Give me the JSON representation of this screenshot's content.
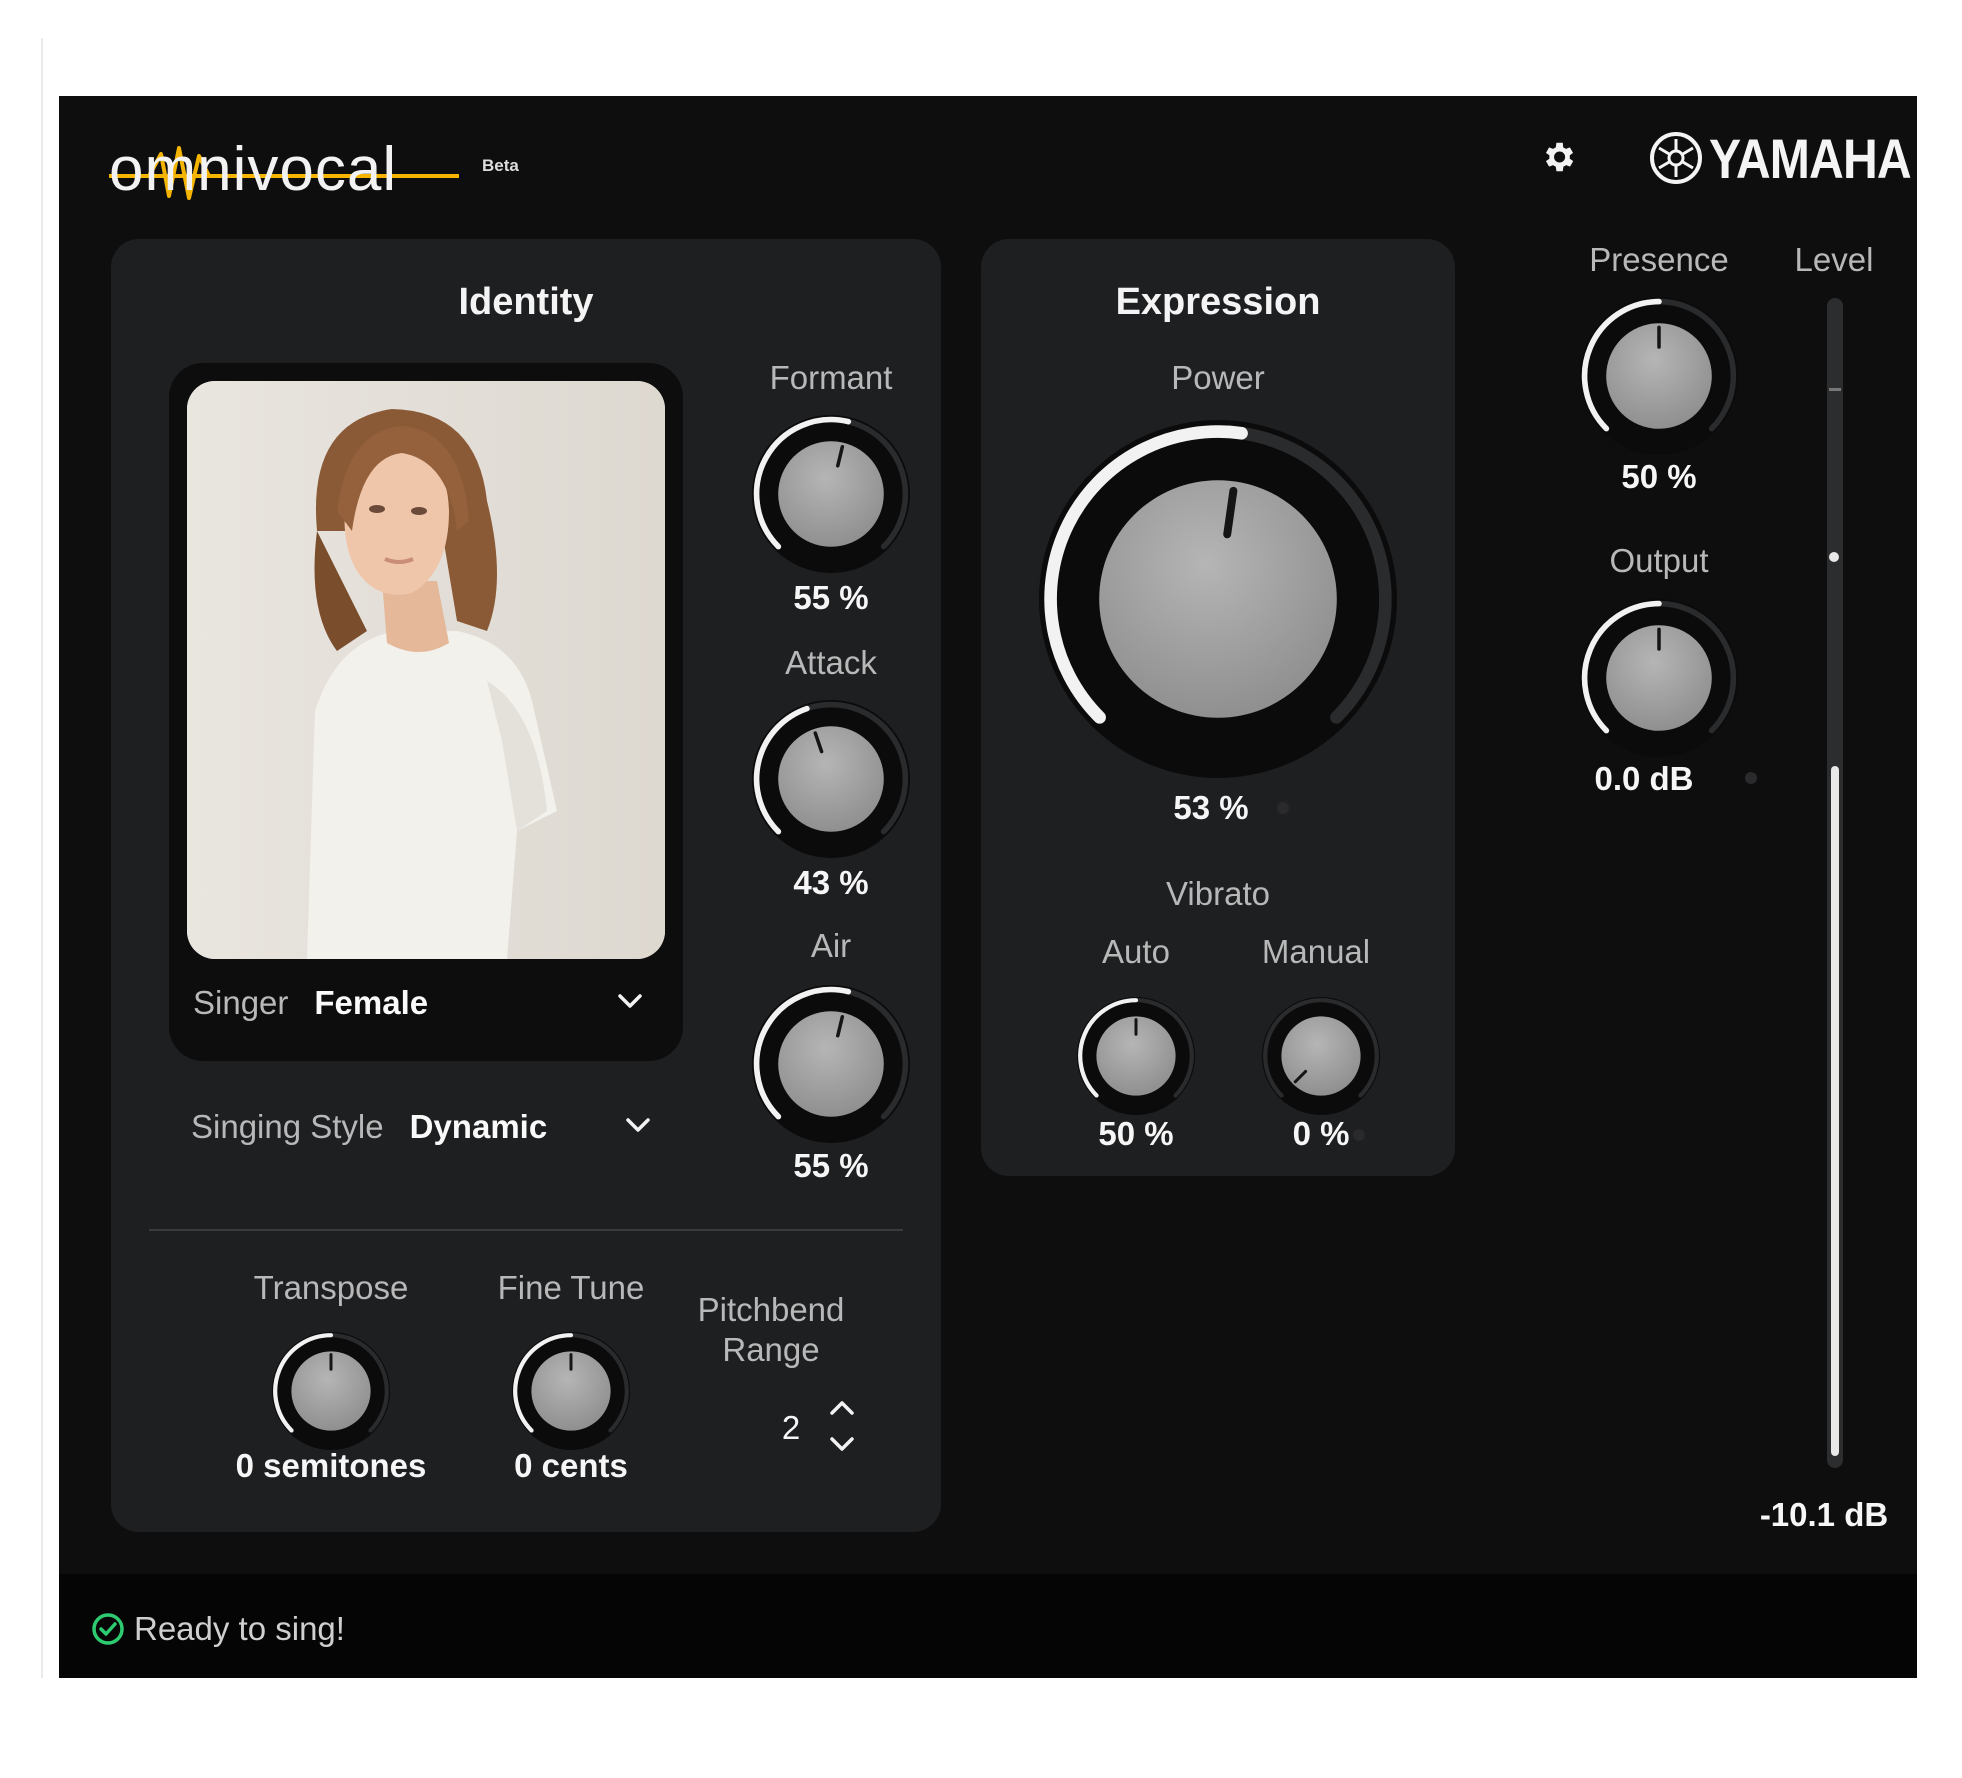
{
  "header": {
    "logo_text": "omnivocal",
    "beta_label": "Beta",
    "brand": "YAMAHA",
    "settings_icon": "gear-icon"
  },
  "identity": {
    "title": "Identity",
    "singer": {
      "label": "Singer",
      "value": "Female"
    },
    "singing_style": {
      "label": "Singing Style",
      "value": "Dynamic"
    },
    "formant": {
      "label": "Formant",
      "value": "55 %",
      "level": 0.55
    },
    "attack": {
      "label": "Attack",
      "value": "43 %",
      "level": 0.43
    },
    "air": {
      "label": "Air",
      "value": "55 %",
      "level": 0.55
    },
    "transpose": {
      "label": "Transpose",
      "value": "0 semitones",
      "level": 0.5
    },
    "fine_tune": {
      "label": "Fine Tune",
      "value": "0 cents",
      "level": 0.5
    },
    "pitchbend": {
      "label_line1": "Pitchbend",
      "label_line2": "Range",
      "value": "2"
    }
  },
  "expression": {
    "title": "Expression",
    "power": {
      "label": "Power",
      "value": "53 %",
      "level": 0.53
    },
    "vibrato": {
      "label": "Vibrato",
      "auto": {
        "label": "Auto",
        "value": "50 %",
        "level": 0.5
      },
      "manual": {
        "label": "Manual",
        "value": "0 %",
        "level": 0.0
      }
    }
  },
  "master": {
    "presence": {
      "label": "Presence",
      "value": "50 %",
      "level": 0.5
    },
    "output": {
      "label": "Output",
      "value": "0.0 dB",
      "level": 0.5
    },
    "level": {
      "label": "Level",
      "value": "-10.1 dB",
      "fill": 0.6
    }
  },
  "status": {
    "text": "Ready to sing!",
    "icon": "check-circle-icon",
    "color": "#2ecc71"
  },
  "colors": {
    "background": "#0e0e0f",
    "panel": "#1e1f21",
    "accent_logo": "#f5b400"
  }
}
